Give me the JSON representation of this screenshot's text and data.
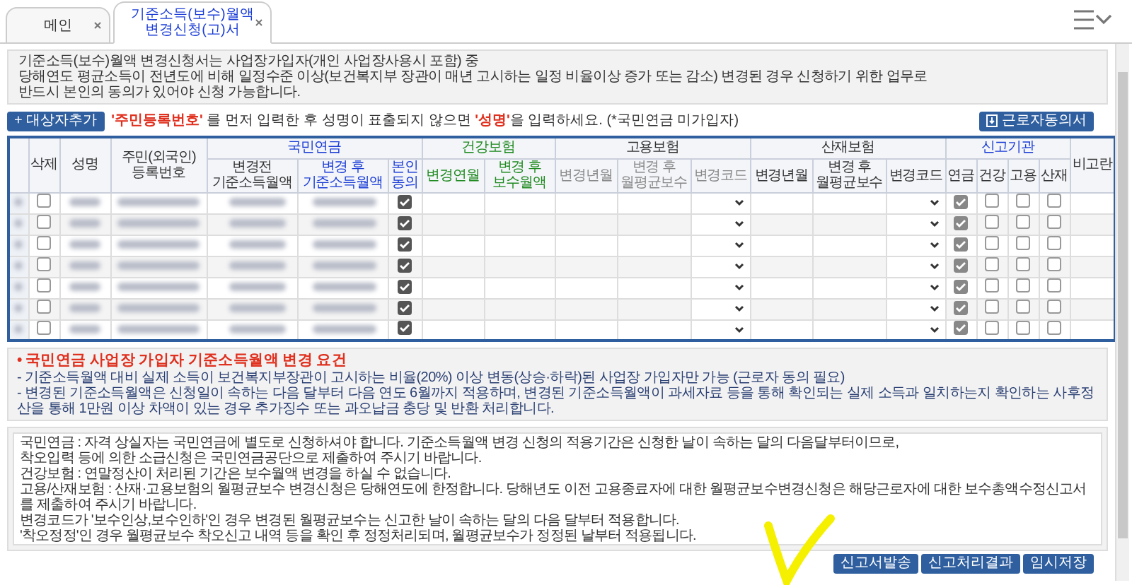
{
  "tabs": [
    {
      "label": "메인",
      "selected": false
    },
    {
      "label": "기준소득(보수)월액\n변경신청(고)서",
      "selected": true
    }
  ],
  "intro": [
    "기준소득(보수)월액 변경신청서는 사업장가입자(개인 사업장사용시 포함) 중",
    "당해연도 평균소득이 전년도에 비해 일정수준 이상(보건복지부 장관이 매년 고시하는 일정 비율이상 증가 또는 감소) 변경된 경우 신청하기 위한 업무로",
    "반드시 본인의 동의가 있어야 신청 가능합니다."
  ],
  "add_button": "+ 대상자추가",
  "hint": {
    "key1": "'주민등록번호'",
    "mid": " 를 먼저 입력한 후 성명이 표출되지 않으면 ",
    "key2": "'성명'",
    "end": "을 입력하세요. (*국민연금 미가입자)"
  },
  "consent_button": "근로자동의서",
  "table": {
    "groups": [
      {
        "label": "국민연금",
        "kind": "pension"
      },
      {
        "label": "건강보험",
        "kind": "health"
      },
      {
        "label": "고용보험",
        "kind": "plain"
      },
      {
        "label": "산재보험",
        "kind": "plain"
      },
      {
        "label": "신고기관",
        "kind": "agency"
      }
    ],
    "columns": [
      "삭제",
      "성명",
      "주민(외국인)\n등록번호",
      "변경전\n기준소득월액",
      "변경 후\n기준소득월액",
      "본인\n동의",
      "변경연월",
      "변경 후\n보수월액",
      "변경년월",
      "변경 후\n월평균보수",
      "변경코드",
      "변경년월",
      "변경 후\n월평균보수",
      "변경코드",
      "연금",
      "건강",
      "고용",
      "산재",
      "비고란"
    ],
    "rows": [
      {
        "delete": false,
        "consent": true,
        "pension": true,
        "health": false,
        "employment": false,
        "accident": false
      },
      {
        "delete": false,
        "consent": true,
        "pension": true,
        "health": false,
        "employment": false,
        "accident": false
      },
      {
        "delete": false,
        "consent": true,
        "pension": true,
        "health": false,
        "employment": false,
        "accident": false
      },
      {
        "delete": false,
        "consent": true,
        "pension": true,
        "health": false,
        "employment": false,
        "accident": false
      },
      {
        "delete": false,
        "consent": true,
        "pension": true,
        "health": false,
        "employment": false,
        "accident": false
      },
      {
        "delete": false,
        "consent": true,
        "pension": true,
        "health": false,
        "employment": false,
        "accident": false
      },
      {
        "delete": false,
        "consent": true,
        "pension": true,
        "health": false,
        "employment": false,
        "accident": false
      }
    ]
  },
  "requirements": {
    "title": "• 국민연금 사업장 가입자 기준소득월액 변경 요건",
    "lines": [
      "- 기준소득월액 대비 실제 소득이 보건복지부장관이 고시하는 비율(20%) 이상 변동(상승·하락)된 사업장 가입자만 가능 (근로자 동의 필요)",
      "- 변경된 기준소득월액은 신청일이 속하는 다음 달부터 다음 연도 6월까지 적용하며, 변경된 기준소득월액이 과세자료 등을 통해 확인되는 실제 소득과 일치하는지 확인하는 사후정산을 통해 1만원 이상 차액이 있는 경우 추가징수 또는 과오납금 충당 및 반환 처리합니다."
    ]
  },
  "notes": [
    "국민연금 : 자격 상실자는 국민연금에 별도로 신청하셔야 합니다. 기준소득월액 변경 신청의 적용기간은 신청한 날이 속하는 달의 다음달부터이므로,",
    "착오입력 등에 의한 소급신청은 국민연금공단으로 제출하여 주시기 바랍니다.",
    "건강보험 : 연말정산이 처리된 기간은 보수월액 변경을 하실 수 없습니다.",
    "고용/산재보험 : 산재·고용보험의 월평균보수 변경신청은 당해연도에 한정합니다. 당해년도 이전 고용종료자에 대한 월평균보수변경신청은 해당근로자에 대한 보수총액수정신고서를 제출하여 주시기 바랍니다.",
    "변경코드가 '보수인상,보수인하'인 경우 변경된 월평균보수는 신고한 날이 속하는 달의 다음 달부터 적용합니다.",
    "'착오정정'인 경우 월평균보수 착오신고 내역 등을 확인 후 정정처리되며, 월평균보수가 정정된 날부터 적용됩니다."
  ],
  "buttons": [
    "신고서발송",
    "신고처리결과",
    "임시저장"
  ]
}
